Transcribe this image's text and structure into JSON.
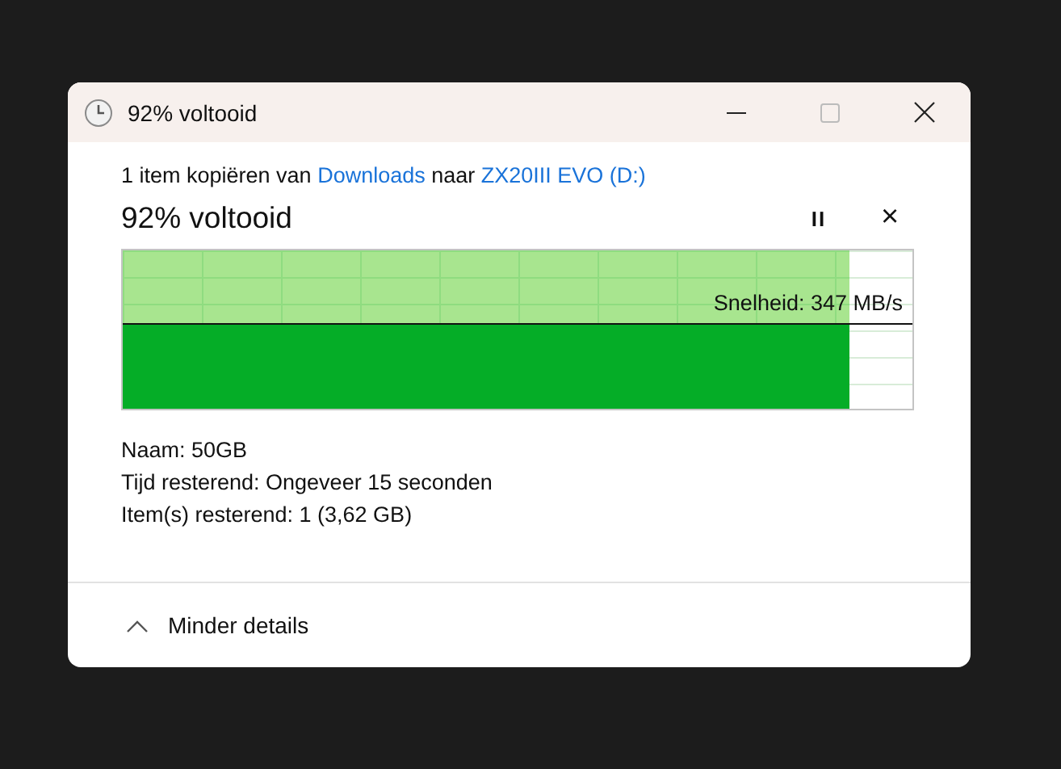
{
  "window": {
    "title": "92% voltooid"
  },
  "header": {
    "prefix": "1 item kopiëren van",
    "source": "Downloads",
    "middle": "naar",
    "destination": "ZX20III EVO (D:)"
  },
  "progress": {
    "title": "92% voltooid",
    "level": 0.92,
    "speed": "Snelheid: 347 MB/s",
    "pause": "II",
    "cancel": "×"
  },
  "details": [
    "Naam: 50GB",
    "Tijd resterend: Ongeveer 15 seconden",
    "Item(s) resterend: 1 (3,62 GB)"
  ],
  "footer": {
    "toggle": "Minder details",
    "expanded": true
  }
}
